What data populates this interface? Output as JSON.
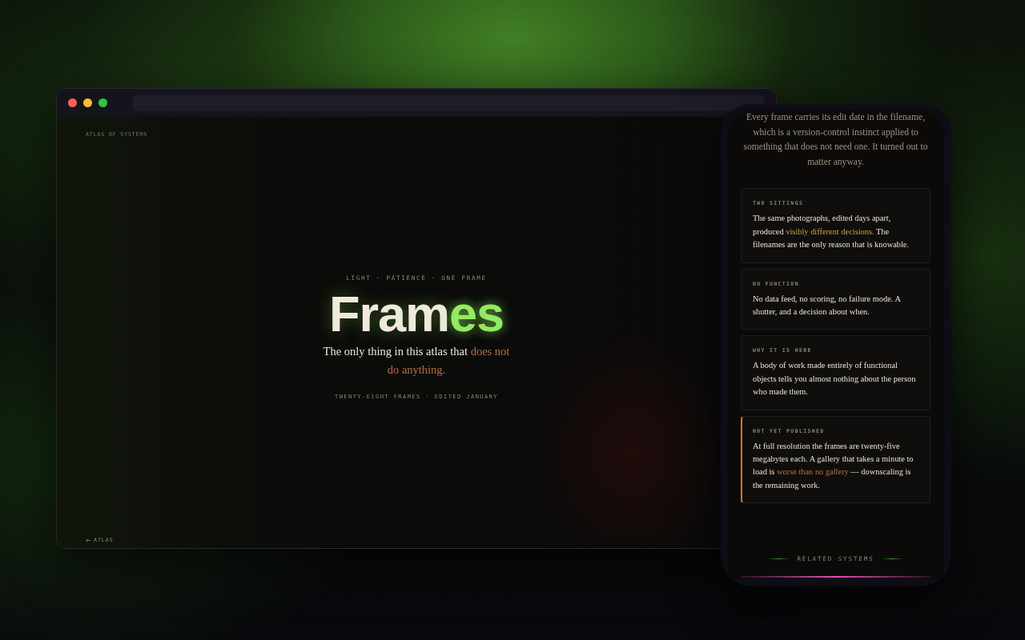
{
  "browser": {
    "site_label": "ATLAS OF SYSTEMS",
    "hero": {
      "tagline": "LIGHT · PATIENCE · ONE FRAME",
      "title": [
        {
          "text": "Fram",
          "kind": "plain"
        },
        {
          "text": "es",
          "kind": "glow"
        }
      ],
      "subtitle": [
        {
          "text": "The only thing in this atlas that ",
          "kind": "plain"
        },
        {
          "text": "does not do anything.",
          "kind": "rust"
        }
      ],
      "meta": "TWENTY-EIGHT FRAMES · EDITED JANUARY"
    },
    "back_link": "ATLAS"
  },
  "phone": {
    "intro": "Every frame carries its edit date in the filename, which is a version-control instinct applied to something that does not need one. It turned out to matter anyway.",
    "cards": [
      {
        "label": "TWO SITTINGS",
        "accent": false,
        "body": [
          {
            "text": "The same photographs, edited days apart, produced ",
            "kind": "plain"
          },
          {
            "text": "visibly different decisions.",
            "kind": "gold"
          },
          {
            "text": " The filenames are the only reason that is knowable.",
            "kind": "plain"
          }
        ]
      },
      {
        "label": "NO FUNCTION",
        "accent": false,
        "body": [
          {
            "text": "No data feed, no scoring, no failure mode. A shutter, and a decision about when.",
            "kind": "plain"
          }
        ]
      },
      {
        "label": "WHY IT IS HERE",
        "accent": false,
        "body": [
          {
            "text": "A body of work made entirely of functional objects tells you almost nothing about the person who made them.",
            "kind": "plain"
          }
        ]
      },
      {
        "label": "NOT YET PUBLISHED",
        "accent": true,
        "body": [
          {
            "text": "At full resolution the frames are twenty-five megabytes each. A gallery that takes a minute to load is ",
            "kind": "plain"
          },
          {
            "text": "worse than no gallery",
            "kind": "rust"
          },
          {
            "text": " — downscaling is the remaining work.",
            "kind": "plain"
          }
        ]
      }
    ],
    "footer_heading": "RELATED SYSTEMS"
  }
}
